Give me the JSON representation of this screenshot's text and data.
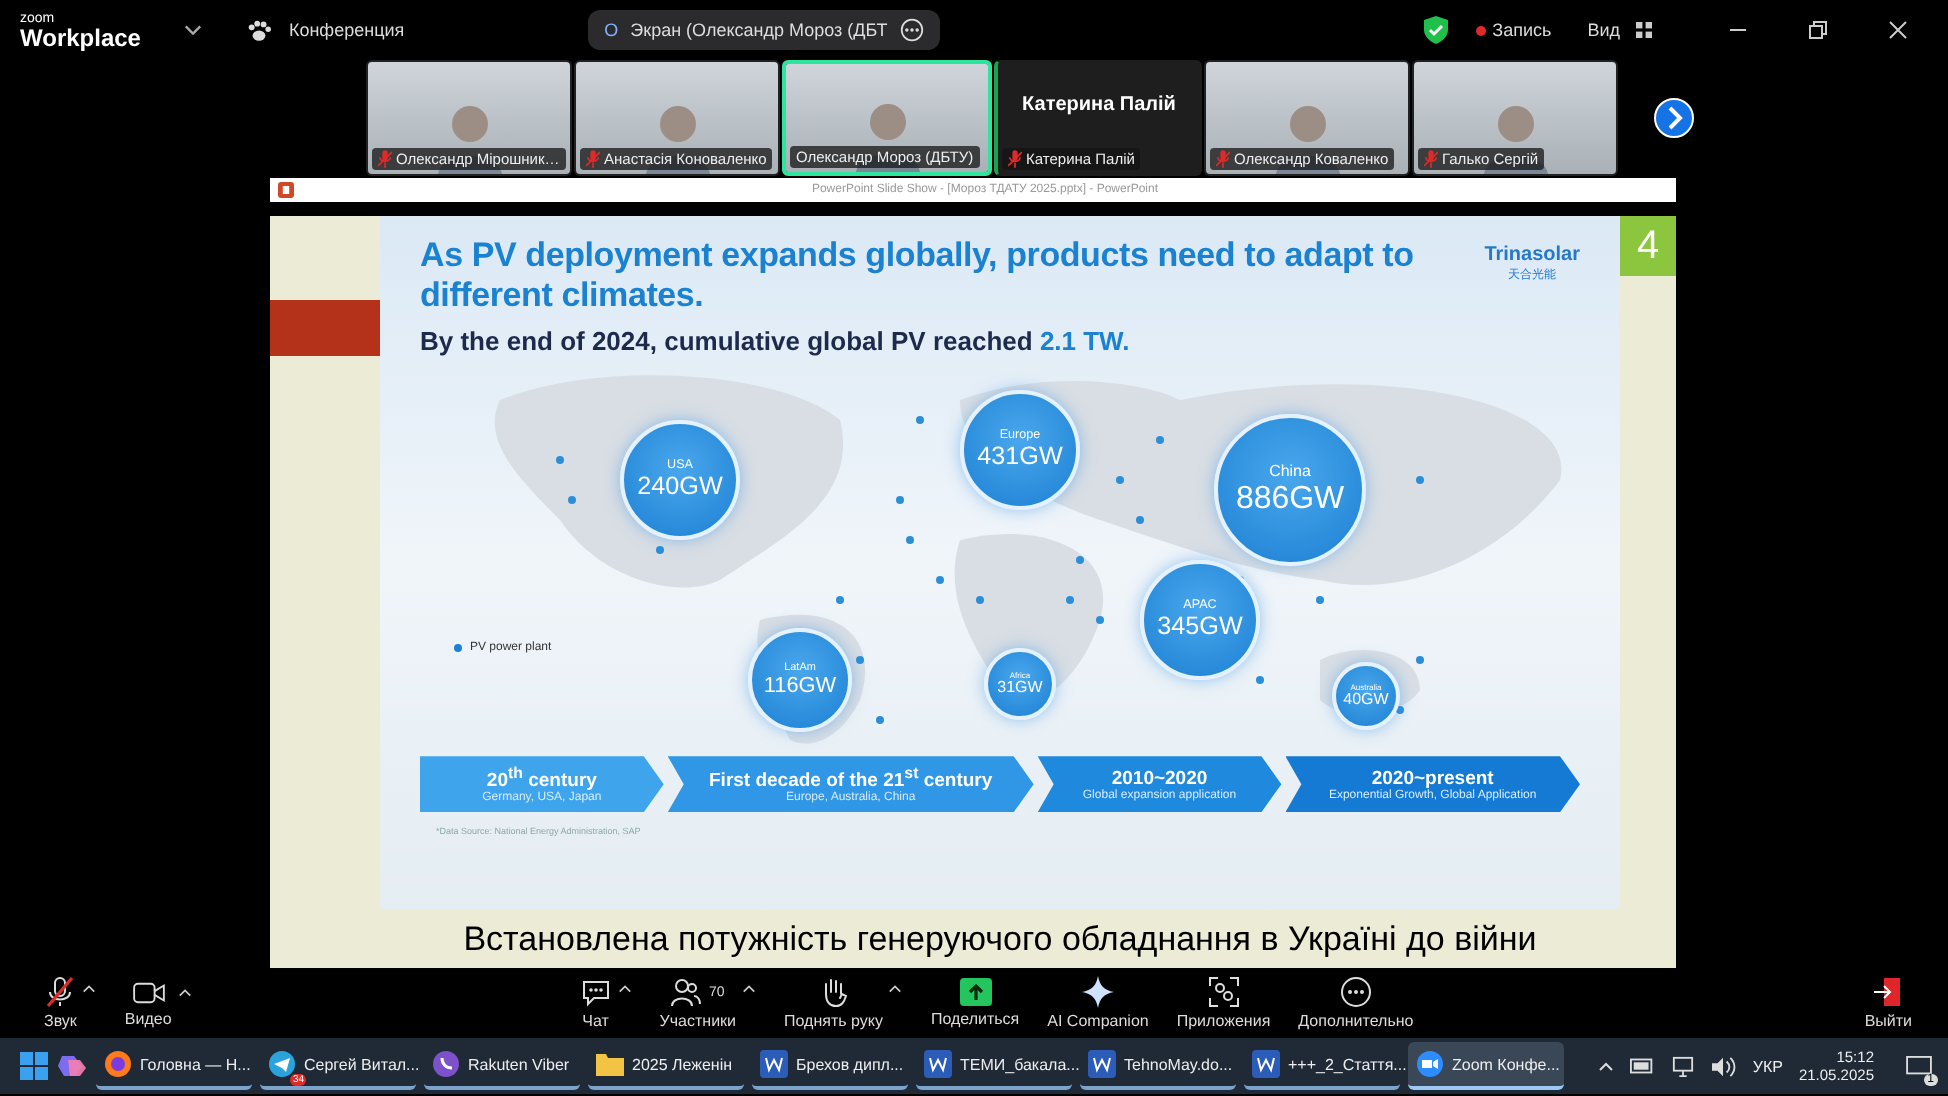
{
  "top_bar": {
    "logo_small": "zoom",
    "logo": "Workplace",
    "meeting": "Конференция",
    "share_pill": {
      "badge": "О",
      "label": "Экран (Олександр Мороз (ДБТ"
    },
    "recording": "Запись",
    "view": "Вид"
  },
  "participants": [
    {
      "name": "Олександр Мірошник…",
      "video": true,
      "muted": true,
      "active": false
    },
    {
      "name": "Анастасія Коноваленко",
      "video": true,
      "muted": true,
      "active": false
    },
    {
      "name": "Олександр Мороз (ДБТУ)",
      "video": true,
      "muted": false,
      "active": true
    },
    {
      "name": "Катерина Палій",
      "display_name": "Катерина Палій",
      "video": false,
      "muted": true,
      "active": false
    },
    {
      "name": "Олександр Коваленко",
      "video": true,
      "muted": true,
      "active": false
    },
    {
      "name": "Галько Сергій",
      "video": true,
      "muted": true,
      "active": false
    }
  ],
  "ppt_title": "PowerPoint Slide Show - [Мороз ТДАТУ 2025.pptx] - PowerPoint",
  "slide": {
    "number": "4",
    "title": "As PV deployment expands globally, products need to adapt to different climates.",
    "logo": "Trinasolar",
    "logo_sub": "天合光能",
    "subtitle": "By the end of 2024, cumulative global PV reached **2.1 TW.**",
    "legend": "PV power plant",
    "regions": [
      {
        "name": "USA",
        "value": "240GW"
      },
      {
        "name": "Europe",
        "value": "431GW"
      },
      {
        "name": "China",
        "value": "886GW"
      },
      {
        "name": "APAC",
        "value": "345GW"
      },
      {
        "name": "LatAm",
        "value": "116GW"
      },
      {
        "name": "Africa",
        "value": "31GW"
      },
      {
        "name": "Australia",
        "value": "40GW"
      }
    ],
    "timeline": [
      {
        "title": "20$^{th}$ century",
        "subtitle": "Germany, USA, Japan"
      },
      {
        "title": "First decade of the 21$^{st}$ century",
        "subtitle": "Europe, Australia, China"
      },
      {
        "title": "2010~2020",
        "subtitle": "Global expansion application"
      },
      {
        "title": "2020~present",
        "subtitle": "Exponential Growth, Global Application"
      }
    ],
    "source": "*Data Source: National Energy Administration, SAP",
    "caption": "Встановлена потужність генеруючого обладнання в Україні до війни"
  },
  "toolbar": [
    {
      "kind": "audio",
      "label": "Звук",
      "muted": true
    },
    {
      "kind": "video",
      "label": "Видео"
    },
    {
      "kind": "chat",
      "label": "Чат"
    },
    {
      "kind": "participants",
      "label": "Участники",
      "count": "70"
    },
    {
      "kind": "hand",
      "label": "Поднять руку"
    },
    {
      "kind": "share",
      "label": "Поделиться"
    },
    {
      "kind": "ai",
      "label": "AI Companion"
    },
    {
      "kind": "apps",
      "label": "Приложения"
    },
    {
      "kind": "more",
      "label": "Дополнительно"
    },
    {
      "kind": "leave",
      "label": "Выйти"
    }
  ],
  "taskbar": {
    "apps": [
      {
        "kind": "firefox",
        "label": "Головна — Н...",
        "selected": false
      },
      {
        "kind": "telegram",
        "label": "Сергей Витал...",
        "badge": "34",
        "selected": false
      },
      {
        "kind": "viber",
        "label": "Rakuten Viber",
        "selected": false
      },
      {
        "kind": "folder",
        "label": "2025 Леженін",
        "selected": false
      },
      {
        "kind": "word",
        "label": "Брехов дипл...",
        "selected": false
      },
      {
        "kind": "word",
        "label": "ТЕМИ_бакала...",
        "selected": false
      },
      {
        "kind": "word",
        "label": "TehnoMay.do...",
        "selected": false
      },
      {
        "kind": "word",
        "label": "+++_2_Стаття...",
        "selected": false
      },
      {
        "kind": "zoom",
        "label": "Zoom Конфе...",
        "selected": true
      }
    ],
    "language": "УКР",
    "time": "15:12",
    "date": "21.05.2025",
    "notifications": "1"
  }
}
